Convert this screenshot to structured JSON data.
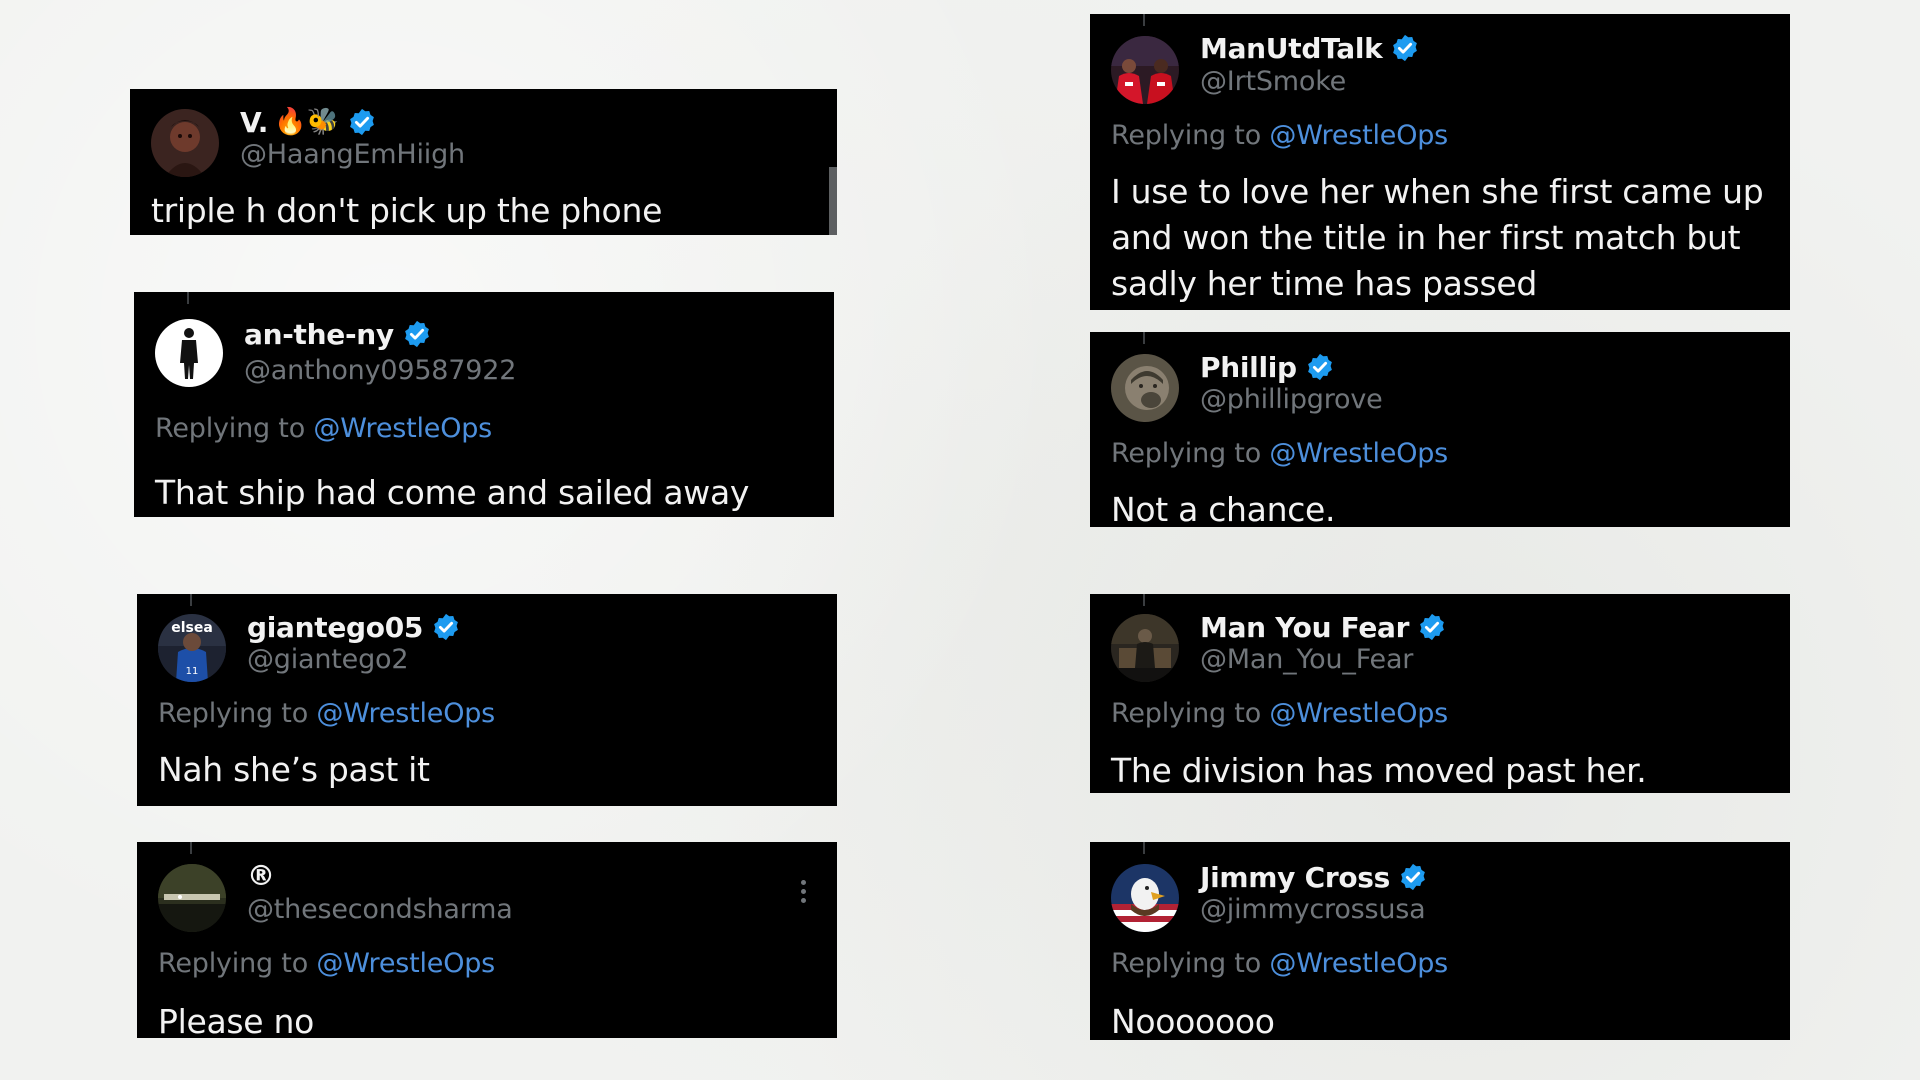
{
  "accent_colors": {
    "verified_blue": "#1d9bf0",
    "mention_blue": "#4d8fdc",
    "muted_gray": "#71767b",
    "card_background": "#000000",
    "page_background": "#f1f2f0"
  },
  "tweets": [
    {
      "id": "v",
      "display_name": "V.",
      "name_emoji": "🔥🐝",
      "verified": true,
      "handle": "@HaangEmHiigh",
      "replying_prefix": "",
      "replying_to": "",
      "text": "triple h don't pick up the phone",
      "avatar_icon": "dark-portrait-avatar"
    },
    {
      "id": "anthe",
      "display_name": "an-the-ny",
      "verified": true,
      "handle": "@anthony09587922",
      "replying_prefix": "Replying to",
      "replying_to": "@WrestleOps",
      "text": "That ship had come and sailed away",
      "avatar_icon": "suited-figure-avatar"
    },
    {
      "id": "giantego",
      "display_name": "giantego05",
      "verified": true,
      "handle": "@giantego2",
      "replying_prefix": "Replying to",
      "replying_to": "@WrestleOps",
      "text": "Nah she’s past it",
      "avatar_icon": "chelsea-player-avatar",
      "avatar_text": "elsea"
    },
    {
      "id": "sharma",
      "display_name": "®",
      "verified": false,
      "handle": "@thesecondsharma",
      "replying_prefix": "Replying to",
      "replying_to": "@WrestleOps",
      "text": "Please no",
      "avatar_icon": "night-scene-avatar",
      "has_more_menu": true
    },
    {
      "id": "manutd",
      "display_name": "ManUtdTalk",
      "verified": true,
      "handle": "@IrtSmoke",
      "replying_prefix": "Replying to",
      "replying_to": "@WrestleOps",
      "text": "I use to love her when she first came up and won the title in her first match but sadly her time has passed",
      "avatar_icon": "man-utd-players-avatar"
    },
    {
      "id": "phillip",
      "display_name": "Phillip",
      "verified": true,
      "handle": "@phillipgrove",
      "replying_prefix": "Replying to",
      "replying_to": "@WrestleOps",
      "text": "Not a chance.",
      "avatar_icon": "sepia-face-avatar"
    },
    {
      "id": "manyoufear",
      "display_name": "Man You Fear",
      "verified": true,
      "handle": "@Man_You_Fear",
      "replying_prefix": "Replying to",
      "replying_to": "@WrestleOps",
      "text": "The division has moved past her.",
      "avatar_icon": "seated-figure-avatar"
    },
    {
      "id": "jimmy",
      "display_name": "Jimmy Cross",
      "verified": true,
      "handle": "@jimmycrossusa",
      "replying_prefix": "Replying to",
      "replying_to": "@WrestleOps",
      "text": "Nooooooo",
      "avatar_icon": "eagle-flag-avatar"
    }
  ]
}
